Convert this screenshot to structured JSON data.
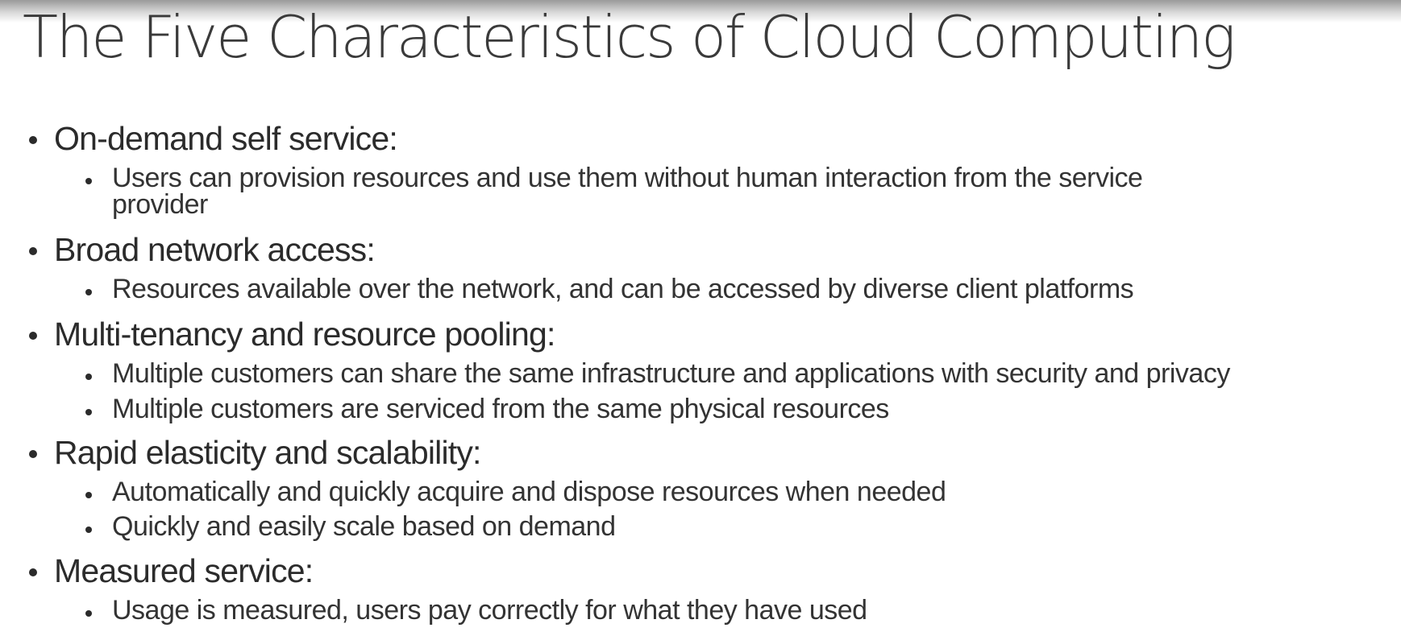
{
  "slide": {
    "title": "The Five Characteristics of Cloud Computing",
    "items": [
      {
        "heading": "On-demand self service:",
        "subs": [
          "Users can provision resources and use them without human interaction from the service",
          "provider"
        ]
      },
      {
        "heading": "Broad network access:",
        "subs": [
          "Resources available over the network, and can be accessed by diverse client platforms"
        ]
      },
      {
        "heading": "Multi-tenancy and resource pooling:",
        "subs": [
          "Multiple customers can share the same infrastructure and applications with security and privacy",
          "Multiple customers are serviced from the same physical resources"
        ]
      },
      {
        "heading": "Rapid elasticity and scalability:",
        "subs": [
          "Automatically and quickly acquire and dispose resources when needed",
          "Quickly and easily scale based on demand"
        ]
      },
      {
        "heading": "Measured service:",
        "subs": [
          "Usage is measured, users pay correctly for what they have used"
        ]
      }
    ]
  }
}
